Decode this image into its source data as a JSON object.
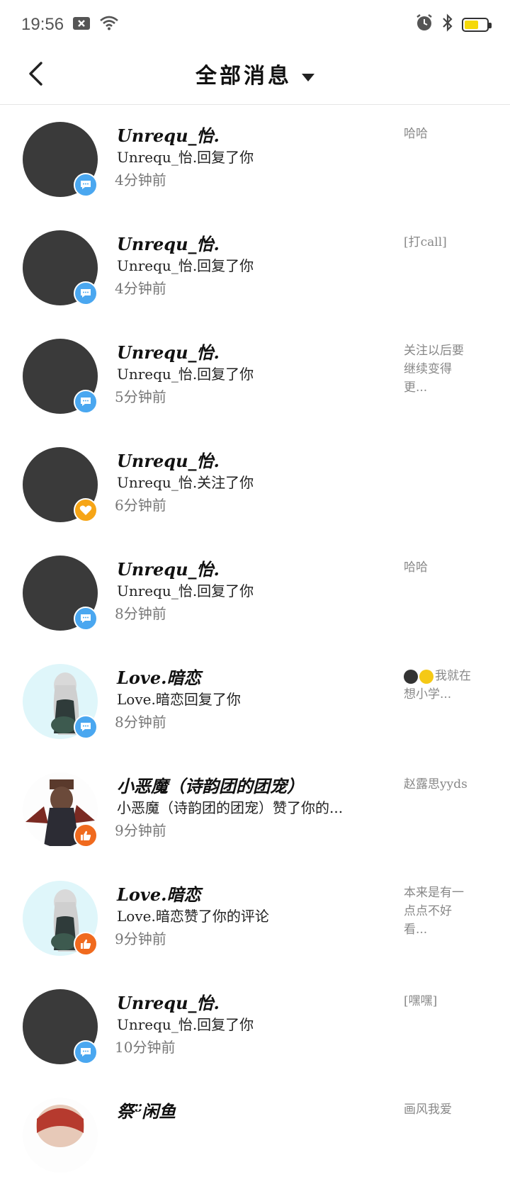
{
  "status_bar": {
    "time": "19:56",
    "icons": [
      "notification-x-icon",
      "wifi-icon",
      "alarm-icon",
      "bluetooth-icon",
      "battery-icon"
    ],
    "battery_color": "#f5d90a"
  },
  "header": {
    "title": "全部消息",
    "back_icon": "chevron-left-icon",
    "dropdown_icon": "caret-down-icon"
  },
  "messages": [
    {
      "name": "Unrequ_怡.",
      "action": "Unrequ_怡.回复了你",
      "time": "4分钟前",
      "preview": "哈哈",
      "badge": "comment"
    },
    {
      "name": "Unrequ_怡.",
      "action": "Unrequ_怡.回复了你",
      "time": "4分钟前",
      "preview": "[打call]",
      "badge": "comment"
    },
    {
      "name": "Unrequ_怡.",
      "action": "Unrequ_怡.回复了你",
      "time": "5分钟前",
      "preview": "关注以后要继续变得更...",
      "badge": "comment"
    },
    {
      "name": "Unrequ_怡.",
      "action": "Unrequ_怡.关注了你",
      "time": "6分钟前",
      "preview": "",
      "badge": "follow"
    },
    {
      "name": "Unrequ_怡.",
      "action": "Unrequ_怡.回复了你",
      "time": "8分钟前",
      "preview": "哈哈",
      "badge": "comment"
    },
    {
      "name": "Love.暗恋",
      "action": "Love.暗恋回复了你",
      "time": "8分钟前",
      "preview": "我就在想小学...",
      "badge": "comment"
    },
    {
      "name": "小恶魔（诗韵团的团宠）",
      "action": "小恶魔（诗韵团的团宠）赞了你的...",
      "time": "9分钟前",
      "preview": "赵露思yyds",
      "badge": "like"
    },
    {
      "name": "Love.暗恋",
      "action": "Love.暗恋赞了你的评论",
      "time": "9分钟前",
      "preview": "本来是有一点点不好看...",
      "badge": "like"
    },
    {
      "name": "Unrequ_怡.",
      "action": "Unrequ_怡.回复了你",
      "time": "10分钟前",
      "preview": "[嘿嘿]",
      "badge": "comment"
    },
    {
      "name": "祭ᵕ̈闲鱼",
      "action": "",
      "time": "",
      "preview": "画风我爱",
      "badge": ""
    }
  ],
  "colors": {
    "comment_badge": "#4aa7f0",
    "follow_badge": "#f6a516",
    "like_badge": "#f06a1e"
  }
}
